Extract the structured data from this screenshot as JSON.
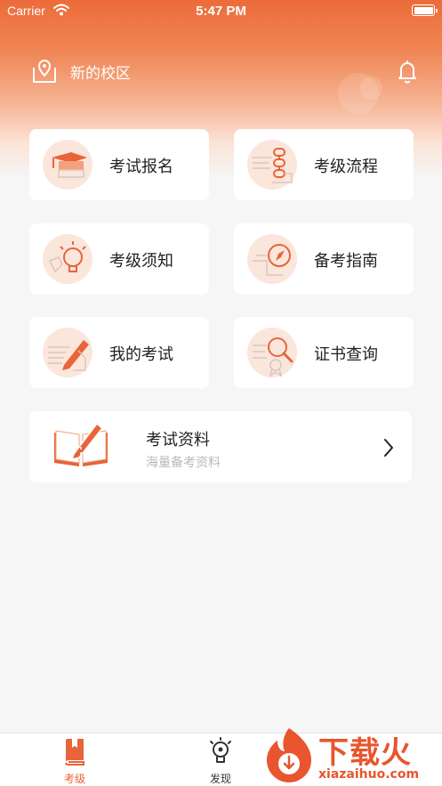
{
  "status_bar": {
    "carrier": "Carrier",
    "time": "5:47 PM"
  },
  "header": {
    "campus_label": "新的校区"
  },
  "grid": [
    {
      "label": "考试报名",
      "icon": "graduation-cap-icon"
    },
    {
      "label": "考级流程",
      "icon": "flow-steps-icon"
    },
    {
      "label": "考级须知",
      "icon": "lightbulb-icon"
    },
    {
      "label": "备考指南",
      "icon": "compass-icon"
    },
    {
      "label": "我的考试",
      "icon": "pencil-notes-icon"
    },
    {
      "label": "证书查询",
      "icon": "certificate-search-icon"
    }
  ],
  "materials": {
    "title": "考试资料",
    "subtitle": "海量备考资料",
    "icon": "open-book-pencil-icon"
  },
  "tabbar": {
    "tabs": [
      {
        "label": "考级"
      },
      {
        "label": "发现"
      }
    ]
  },
  "watermark": {
    "text": "下载火",
    "url": "xiazaihuo.com"
  },
  "colors": {
    "accent": "#e8643a",
    "header_top": "#ec6b3a",
    "background": "#f6f6f6"
  }
}
